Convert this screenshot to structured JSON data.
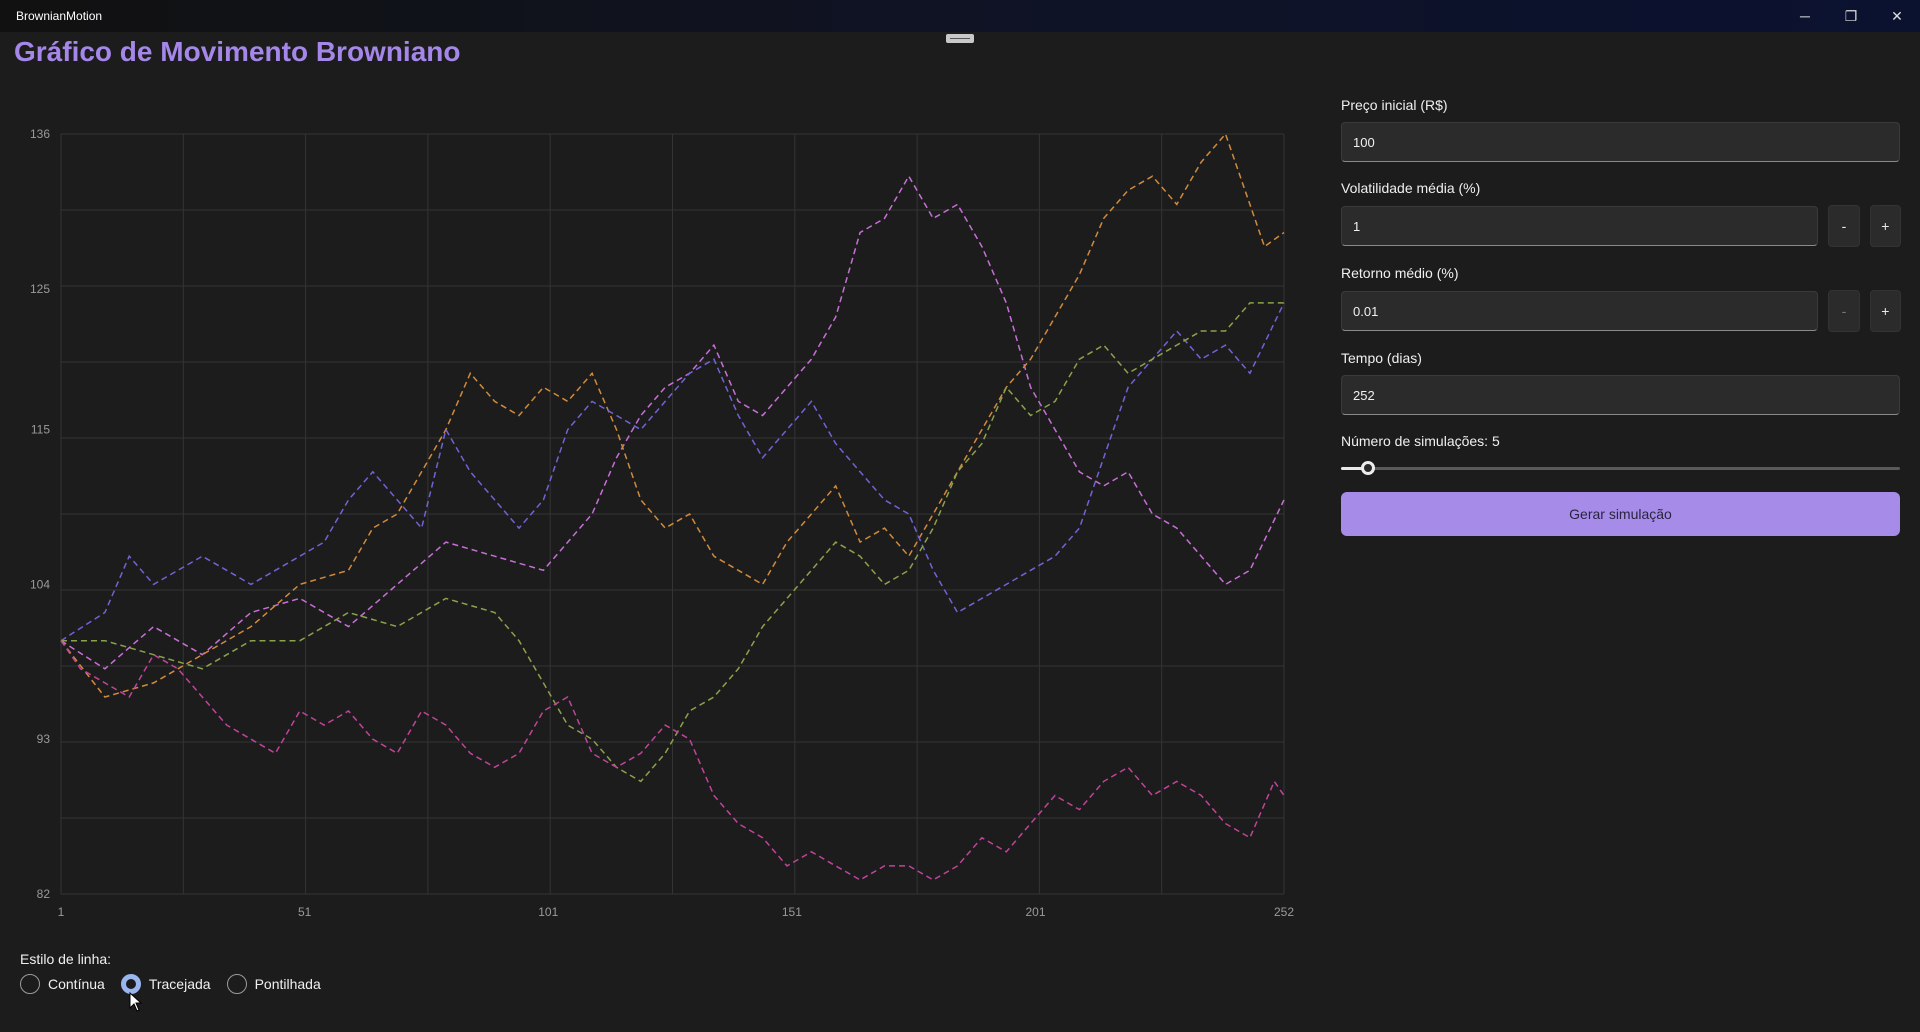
{
  "window": {
    "title": "BrownianMotion"
  },
  "page": {
    "title": "Gráfico de Movimento Browniano"
  },
  "controls": {
    "initial_price": {
      "label": "Preço inicial (R$)",
      "value": "100"
    },
    "volatility": {
      "label": "Volatilidade média (%)",
      "value": "1",
      "dec": "-",
      "inc": "+"
    },
    "mean_return": {
      "label": "Retorno médio (%)",
      "value": "0.01",
      "dec": "-",
      "inc": "+"
    },
    "time_days": {
      "label": "Tempo (dias)",
      "value": "252"
    },
    "simulations": {
      "label": "Número de simulações: 5",
      "value": 5
    },
    "generate_label": "Gerar simulação"
  },
  "line_style": {
    "label": "Estilo de linha:",
    "options": [
      "Contínua",
      "Tracejada",
      "Pontilhada"
    ],
    "selected": "Tracejada"
  },
  "chart_data": {
    "type": "line",
    "line_style": "dashed",
    "grid": true,
    "legend": "none",
    "xlim": [
      1,
      252
    ],
    "ylim": [
      82,
      136
    ],
    "x_ticks": [
      "1",
      "51",
      "101",
      "151",
      "201",
      "252"
    ],
    "y_ticks": [
      "82",
      "93",
      "104",
      "115",
      "125",
      "136"
    ],
    "series_colors": [
      "#c86fd8",
      "#d18a3c",
      "#6f64d6",
      "#8aa24a",
      "#c0449a"
    ],
    "series": [
      {
        "color": "#c86fd8",
        "points": [
          [
            1,
            100
          ],
          [
            10,
            98
          ],
          [
            20,
            101
          ],
          [
            30,
            99
          ],
          [
            40,
            102
          ],
          [
            50,
            103
          ],
          [
            60,
            101
          ],
          [
            70,
            104
          ],
          [
            80,
            107
          ],
          [
            90,
            106
          ],
          [
            100,
            105
          ],
          [
            110,
            109
          ],
          [
            115,
            113
          ],
          [
            120,
            116
          ],
          [
            125,
            118
          ],
          [
            130,
            119
          ],
          [
            135,
            121
          ],
          [
            140,
            117
          ],
          [
            145,
            116
          ],
          [
            150,
            118
          ],
          [
            155,
            120
          ],
          [
            160,
            123
          ],
          [
            165,
            129
          ],
          [
            170,
            130
          ],
          [
            175,
            133
          ],
          [
            180,
            130
          ],
          [
            185,
            131
          ],
          [
            190,
            128
          ],
          [
            195,
            124
          ],
          [
            200,
            118
          ],
          [
            205,
            115
          ],
          [
            210,
            112
          ],
          [
            215,
            111
          ],
          [
            220,
            112
          ],
          [
            225,
            109
          ],
          [
            230,
            108
          ],
          [
            235,
            106
          ],
          [
            240,
            104
          ],
          [
            245,
            105
          ],
          [
            252,
            110
          ]
        ]
      },
      {
        "color": "#d18a3c",
        "points": [
          [
            1,
            100
          ],
          [
            10,
            96
          ],
          [
            20,
            97
          ],
          [
            30,
            99
          ],
          [
            40,
            101
          ],
          [
            50,
            104
          ],
          [
            60,
            105
          ],
          [
            65,
            108
          ],
          [
            70,
            109
          ],
          [
            75,
            112
          ],
          [
            80,
            115
          ],
          [
            85,
            119
          ],
          [
            90,
            117
          ],
          [
            95,
            116
          ],
          [
            100,
            118
          ],
          [
            105,
            117
          ],
          [
            110,
            119
          ],
          [
            115,
            115
          ],
          [
            120,
            110
          ],
          [
            125,
            108
          ],
          [
            130,
            109
          ],
          [
            135,
            106
          ],
          [
            140,
            105
          ],
          [
            145,
            104
          ],
          [
            150,
            107
          ],
          [
            155,
            109
          ],
          [
            160,
            111
          ],
          [
            165,
            107
          ],
          [
            170,
            108
          ],
          [
            175,
            106
          ],
          [
            180,
            109
          ],
          [
            185,
            112
          ],
          [
            190,
            115
          ],
          [
            195,
            118
          ],
          [
            200,
            120
          ],
          [
            205,
            123
          ],
          [
            210,
            126
          ],
          [
            215,
            130
          ],
          [
            220,
            132
          ],
          [
            225,
            133
          ],
          [
            230,
            131
          ],
          [
            235,
            134
          ],
          [
            240,
            136
          ],
          [
            245,
            131
          ],
          [
            248,
            128
          ],
          [
            252,
            129
          ]
        ]
      },
      {
        "color": "#6f64d6",
        "points": [
          [
            1,
            100
          ],
          [
            10,
            102
          ],
          [
            15,
            106
          ],
          [
            20,
            104
          ],
          [
            30,
            106
          ],
          [
            40,
            104
          ],
          [
            50,
            106
          ],
          [
            55,
            107
          ],
          [
            60,
            110
          ],
          [
            65,
            112
          ],
          [
            70,
            110
          ],
          [
            75,
            108
          ],
          [
            80,
            115
          ],
          [
            85,
            112
          ],
          [
            90,
            110
          ],
          [
            95,
            108
          ],
          [
            100,
            110
          ],
          [
            105,
            115
          ],
          [
            110,
            117
          ],
          [
            115,
            116
          ],
          [
            120,
            115
          ],
          [
            125,
            117
          ],
          [
            130,
            119
          ],
          [
            135,
            120
          ],
          [
            140,
            116
          ],
          [
            145,
            113
          ],
          [
            150,
            115
          ],
          [
            155,
            117
          ],
          [
            160,
            114
          ],
          [
            165,
            112
          ],
          [
            170,
            110
          ],
          [
            175,
            109
          ],
          [
            180,
            105
          ],
          [
            185,
            102
          ],
          [
            190,
            103
          ],
          [
            195,
            104
          ],
          [
            200,
            105
          ],
          [
            205,
            106
          ],
          [
            210,
            108
          ],
          [
            215,
            113
          ],
          [
            220,
            118
          ],
          [
            225,
            120
          ],
          [
            230,
            122
          ],
          [
            235,
            120
          ],
          [
            240,
            121
          ],
          [
            245,
            119
          ],
          [
            252,
            124
          ]
        ]
      },
      {
        "color": "#8aa24a",
        "points": [
          [
            1,
            100
          ],
          [
            10,
            100
          ],
          [
            20,
            99
          ],
          [
            30,
            98
          ],
          [
            40,
            100
          ],
          [
            50,
            100
          ],
          [
            60,
            102
          ],
          [
            70,
            101
          ],
          [
            80,
            103
          ],
          [
            90,
            102
          ],
          [
            95,
            100
          ],
          [
            100,
            97
          ],
          [
            105,
            94
          ],
          [
            110,
            93
          ],
          [
            115,
            91
          ],
          [
            120,
            90
          ],
          [
            125,
            92
          ],
          [
            130,
            95
          ],
          [
            135,
            96
          ],
          [
            140,
            98
          ],
          [
            145,
            101
          ],
          [
            150,
            103
          ],
          [
            155,
            105
          ],
          [
            160,
            107
          ],
          [
            165,
            106
          ],
          [
            170,
            104
          ],
          [
            175,
            105
          ],
          [
            180,
            108
          ],
          [
            185,
            112
          ],
          [
            190,
            114
          ],
          [
            195,
            118
          ],
          [
            200,
            116
          ],
          [
            205,
            117
          ],
          [
            210,
            120
          ],
          [
            215,
            121
          ],
          [
            220,
            119
          ],
          [
            225,
            120
          ],
          [
            230,
            121
          ],
          [
            235,
            122
          ],
          [
            240,
            122
          ],
          [
            245,
            124
          ],
          [
            252,
            124
          ]
        ]
      },
      {
        "color": "#c0449a",
        "points": [
          [
            1,
            100
          ],
          [
            5,
            98
          ],
          [
            10,
            97
          ],
          [
            15,
            96
          ],
          [
            20,
            99
          ],
          [
            25,
            98
          ],
          [
            30,
            96
          ],
          [
            35,
            94
          ],
          [
            40,
            93
          ],
          [
            45,
            92
          ],
          [
            50,
            95
          ],
          [
            55,
            94
          ],
          [
            60,
            95
          ],
          [
            65,
            93
          ],
          [
            70,
            92
          ],
          [
            75,
            95
          ],
          [
            80,
            94
          ],
          [
            85,
            92
          ],
          [
            90,
            91
          ],
          [
            95,
            92
          ],
          [
            100,
            95
          ],
          [
            105,
            96
          ],
          [
            110,
            92
          ],
          [
            115,
            91
          ],
          [
            120,
            92
          ],
          [
            125,
            94
          ],
          [
            130,
            93
          ],
          [
            135,
            89
          ],
          [
            140,
            87
          ],
          [
            145,
            86
          ],
          [
            150,
            84
          ],
          [
            155,
            85
          ],
          [
            160,
            84
          ],
          [
            165,
            83
          ],
          [
            170,
            84
          ],
          [
            175,
            84
          ],
          [
            180,
            83
          ],
          [
            185,
            84
          ],
          [
            190,
            86
          ],
          [
            195,
            85
          ],
          [
            200,
            87
          ],
          [
            205,
            89
          ],
          [
            210,
            88
          ],
          [
            215,
            90
          ],
          [
            220,
            91
          ],
          [
            225,
            89
          ],
          [
            230,
            90
          ],
          [
            235,
            89
          ],
          [
            240,
            87
          ],
          [
            245,
            86
          ],
          [
            250,
            90
          ],
          [
            252,
            89
          ]
        ]
      }
    ]
  }
}
